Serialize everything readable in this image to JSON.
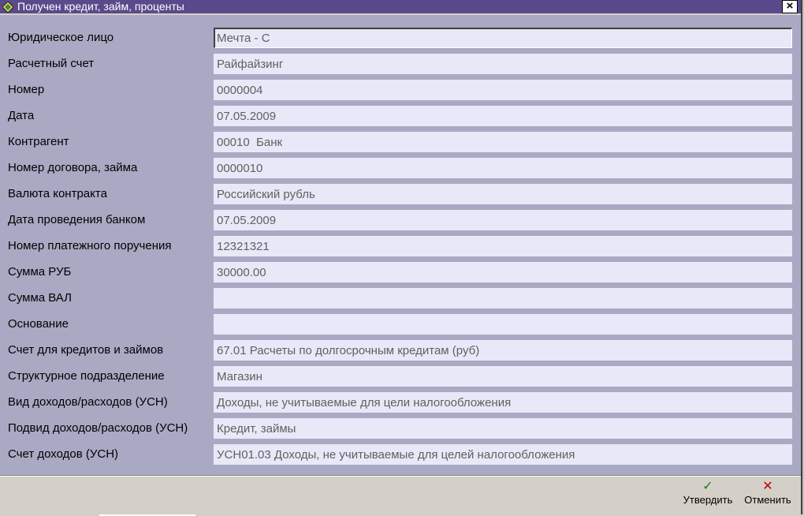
{
  "window": {
    "title": "Получен кредит, займ, проценты",
    "close_glyph": "×",
    "title_icon": "diamond-app-icon",
    "colors": {
      "titlebar": "#5a4a8c",
      "form_bg": "#a9a9c4",
      "field_bg": "#e8e8f8"
    }
  },
  "form": {
    "fields": [
      {
        "label": "Юридическое лицо",
        "value": "Мечта - С"
      },
      {
        "label": "Расчетный счет",
        "value": "Райфайзинг"
      },
      {
        "label": "Номер",
        "value": "0000004"
      },
      {
        "label": "Дата",
        "value": "07.05.2009"
      },
      {
        "label": "Контрагент",
        "value": "00010  Банк"
      },
      {
        "label": "Номер договора, займа",
        "value": "0000010"
      },
      {
        "label": "Валюта контракта",
        "value": "Российский рубль"
      },
      {
        "label": "Дата проведения банком",
        "value": "07.05.2009"
      },
      {
        "label": "Номер платежного поручения",
        "value": "12321321"
      },
      {
        "label": "Сумма РУБ",
        "value": "30000.00"
      },
      {
        "label": "Сумма ВАЛ",
        "value": ""
      },
      {
        "label": "Основание",
        "value": ""
      },
      {
        "label": "Счет для кредитов и займов",
        "value": "67.01 Расчеты по долгосрочным кредитам (руб)"
      },
      {
        "label": "Структурное подразделение",
        "value": "Магазин"
      },
      {
        "label": "Вид доходов/расходов (УСН)",
        "value": "Доходы, не учитываемые для цели налогообложения"
      },
      {
        "label": "Подвид доходов/расходов (УСН)",
        "value": "Кредит, займы"
      },
      {
        "label": "Счет доходов (УСН)",
        "value": "УСН01.03 Доходы, не учитываемые для целей налогообложения"
      }
    ]
  },
  "footer": {
    "approve": {
      "label": "Утвердить",
      "icon": "✓",
      "icon_name": "checkmark-icon"
    },
    "cancel": {
      "label": "Отменить",
      "icon": "✕",
      "icon_name": "cross-icon"
    }
  }
}
